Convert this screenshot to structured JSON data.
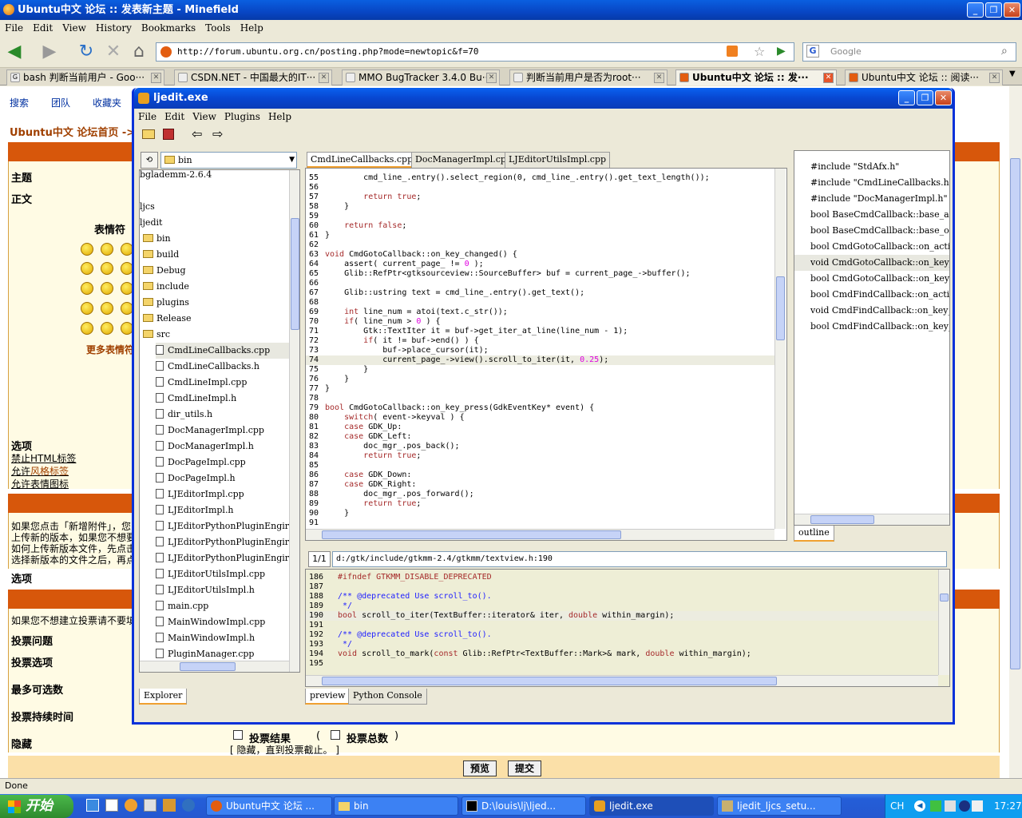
{
  "firefox": {
    "title": "Ubuntu中文 论坛 :: 发表新主题 - Minefield",
    "menu": [
      "File",
      "Edit",
      "View",
      "History",
      "Bookmarks",
      "Tools",
      "Help"
    ],
    "url": "http://forum.ubuntu.org.cn/posting.php?mode=newtopic&f=70",
    "search_placeholder": "Google",
    "tabs": [
      {
        "label": "bash 判断当前用户 - Goo···"
      },
      {
        "label": "CSDN.NET - 中国最大的IT···"
      },
      {
        "label": "MMO BugTracker 3.4.0 Bu···"
      },
      {
        "label": "判断当前用户是否为root···"
      },
      {
        "label": "Ubuntu中文 论坛 :: 发···"
      },
      {
        "label": "Ubuntu中文 论坛 :: 阅读···"
      }
    ],
    "status": "Done"
  },
  "forum": {
    "toplinks": [
      "搜索",
      "团队",
      "收藏夹"
    ],
    "breadcrumb": "Ubuntu中文 论坛首页 ->",
    "subject_label": "主题",
    "body_label": "正文",
    "smilies_label": "表情符",
    "more_smilies": "更多表情符",
    "options_label": "选项",
    "opt_html": "禁止HTML标签",
    "opt_bbcode_prefix": "允许",
    "opt_bbcode_link": "风格标签",
    "opt_smilies": "允许表情图标",
    "attach_lines": [
      "如果您点击「新增附件」，您",
      "上传新的版本，如果您不想要",
      "如何上传新版本文件，先点击",
      "选择新版本的文件之后，再点"
    ],
    "options_label2": "选项",
    "poll_note": "如果您不想建立投票请不要填",
    "poll_question": "投票问题",
    "poll_option": "投票选项",
    "poll_max": "最多可选数",
    "poll_length": "投票持续时间",
    "hide": "隐藏",
    "poll_result": "投票结果",
    "poll_total": "投票总数",
    "hide_note": "[ 隐藏，直到投票截止。 ]",
    "preview_btn": "预览",
    "submit_btn": "提交"
  },
  "ljedit": {
    "title": "ljedit.exe",
    "menu": [
      "File",
      "Edit",
      "View",
      "Plugins",
      "Help"
    ],
    "explorer_path": "bin",
    "tree": [
      {
        "label": "bglademm-2.6.4",
        "type": "text",
        "indent": 0
      },
      {
        "label": "",
        "type": "text",
        "indent": 0
      },
      {
        "label": "ljcs",
        "type": "text",
        "indent": 0
      },
      {
        "label": "ljedit",
        "type": "text",
        "indent": 0
      },
      {
        "label": "bin",
        "type": "folder",
        "indent": 1
      },
      {
        "label": "build",
        "type": "folder",
        "indent": 1
      },
      {
        "label": "Debug",
        "type": "folder",
        "indent": 1
      },
      {
        "label": "include",
        "type": "folder",
        "indent": 1
      },
      {
        "label": "plugins",
        "type": "folder",
        "indent": 1
      },
      {
        "label": "Release",
        "type": "folder",
        "indent": 1
      },
      {
        "label": "src",
        "type": "folder",
        "indent": 1
      },
      {
        "label": "CmdLineCallbacks.cpp",
        "type": "file",
        "indent": 2
      },
      {
        "label": "CmdLineCallbacks.h",
        "type": "file",
        "indent": 2
      },
      {
        "label": "CmdLineImpl.cpp",
        "type": "file",
        "indent": 2
      },
      {
        "label": "CmdLineImpl.h",
        "type": "file",
        "indent": 2
      },
      {
        "label": "dir_utils.h",
        "type": "file",
        "indent": 2
      },
      {
        "label": "DocManagerImpl.cpp",
        "type": "file",
        "indent": 2
      },
      {
        "label": "DocManagerImpl.h",
        "type": "file",
        "indent": 2
      },
      {
        "label": "DocPageImpl.cpp",
        "type": "file",
        "indent": 2
      },
      {
        "label": "DocPageImpl.h",
        "type": "file",
        "indent": 2
      },
      {
        "label": "LJEditorImpl.cpp",
        "type": "file",
        "indent": 2
      },
      {
        "label": "LJEditorImpl.h",
        "type": "file",
        "indent": 2
      },
      {
        "label": "LJEditorPythonPluginEngir",
        "type": "file",
        "indent": 2
      },
      {
        "label": "LJEditorPythonPluginEngir",
        "type": "file",
        "indent": 2
      },
      {
        "label": "LJEditorPythonPluginEngir",
        "type": "file",
        "indent": 2
      },
      {
        "label": "LJEditorUtilsImpl.cpp",
        "type": "file",
        "indent": 2
      },
      {
        "label": "LJEditorUtilsImpl.h",
        "type": "file",
        "indent": 2
      },
      {
        "label": "main.cpp",
        "type": "file",
        "indent": 2
      },
      {
        "label": "MainWindowImpl.cpp",
        "type": "file",
        "indent": 2
      },
      {
        "label": "MainWindowImpl.h",
        "type": "file",
        "indent": 2
      },
      {
        "label": "PluginManager.cpp",
        "type": "file",
        "indent": 2
      },
      {
        "label": "PluginManager.h",
        "type": "file",
        "indent": 2
      }
    ],
    "editor_tabs": [
      "CmdLineCallbacks.cpp",
      "DocManagerImpl.cpp",
      "LJEditorUtilsImpl.cpp"
    ],
    "code_lines": [
      {
        "n": "55",
        "t": "        cmd_line_.entry().select_region(0, cmd_line_.entry().get_text_length());"
      },
      {
        "n": "56",
        "t": ""
      },
      {
        "n": "57",
        "t": "        return true;"
      },
      {
        "n": "58",
        "t": "    }"
      },
      {
        "n": "59",
        "t": ""
      },
      {
        "n": "60",
        "t": "    return false;"
      },
      {
        "n": "61",
        "t": "}"
      },
      {
        "n": "62",
        "t": ""
      },
      {
        "n": "63",
        "t": "void CmdGotoCallback::on_key_changed() {"
      },
      {
        "n": "64",
        "t": "    assert( current_page_ != 0 );"
      },
      {
        "n": "65",
        "t": "    Glib::RefPtr<gtksourceview::SourceBuffer> buf = current_page_->buffer();"
      },
      {
        "n": "66",
        "t": ""
      },
      {
        "n": "67",
        "t": "    Glib::ustring text = cmd_line_.entry().get_text();"
      },
      {
        "n": "68",
        "t": ""
      },
      {
        "n": "69",
        "t": "    int line_num = atoi(text.c_str());"
      },
      {
        "n": "70",
        "t": "    if( line_num > 0 ) {"
      },
      {
        "n": "71",
        "t": "        Gtk::TextIter it = buf->get_iter_at_line(line_num - 1);"
      },
      {
        "n": "72",
        "t": "        if( it != buf->end() ) {"
      },
      {
        "n": "73",
        "t": "            buf->place_cursor(it);"
      },
      {
        "n": "74",
        "t": "            current_page_->view().scroll_to_iter(it, 0.25);"
      },
      {
        "n": "75",
        "t": "        }"
      },
      {
        "n": "76",
        "t": "    }"
      },
      {
        "n": "77",
        "t": "}"
      },
      {
        "n": "78",
        "t": ""
      },
      {
        "n": "79",
        "t": "bool CmdGotoCallback::on_key_press(GdkEventKey* event) {"
      },
      {
        "n": "80",
        "t": "    switch( event->keyval ) {"
      },
      {
        "n": "81",
        "t": "    case GDK_Up:"
      },
      {
        "n": "82",
        "t": "    case GDK_Left:"
      },
      {
        "n": "83",
        "t": "        doc_mgr_.pos_back();"
      },
      {
        "n": "84",
        "t": "        return true;"
      },
      {
        "n": "85",
        "t": ""
      },
      {
        "n": "86",
        "t": "    case GDK_Down:"
      },
      {
        "n": "87",
        "t": "    case GDK_Right:"
      },
      {
        "n": "88",
        "t": "        doc_mgr_.pos_forward();"
      },
      {
        "n": "89",
        "t": "        return true;"
      },
      {
        "n": "90",
        "t": "    }"
      },
      {
        "n": "91",
        "t": ""
      }
    ],
    "outline": [
      "#include \"StdAfx.h\"",
      "#include \"CmdLineCallbacks.h\"",
      "#include \"DocManagerImpl.h\"",
      "bool BaseCmdCallback::base_act",
      "bool BaseCmdCallback::base_on_",
      "bool CmdGotoCallback::on_activ",
      "void CmdGotoCallback::on_key_c",
      "bool CmdGotoCallback::on_key_p",
      "bool CmdFindCallback::on_activ",
      "void CmdFindCallback::on_key_c",
      "bool CmdFindCallback::on_key_p"
    ],
    "outline_tab": "outline",
    "preview_count": "1/1",
    "preview_path": "d:/gtk/include/gtkmm-2.4/gtkmm/textview.h:190",
    "preview_lines": [
      {
        "n": "186",
        "t": "#ifndef GTKMM_DISABLE_DEPRECATED"
      },
      {
        "n": "187",
        "t": ""
      },
      {
        "n": "188",
        "t": "/** @deprecated Use scroll_to()."
      },
      {
        "n": "189",
        "t": " */"
      },
      {
        "n": "190",
        "t": "bool scroll_to_iter(TextBuffer::iterator& iter, double within_margin);"
      },
      {
        "n": "191",
        "t": ""
      },
      {
        "n": "192",
        "t": "/** @deprecated Use scroll_to()."
      },
      {
        "n": "193",
        "t": " */"
      },
      {
        "n": "194",
        "t": "void scroll_to_mark(const Glib::RefPtr<TextBuffer::Mark>& mark, double within_margin);"
      },
      {
        "n": "195",
        "t": ""
      }
    ],
    "bottom_tabs": [
      "preview",
      "Python Console"
    ],
    "explorer_tab": "Explorer"
  },
  "taskbar": {
    "start": "开始",
    "items": [
      "Ubuntu中文 论坛 ...",
      "bin",
      "D:\\louis\\lj\\ljed...",
      "ljedit.exe",
      "ljedit_ljcs_setu..."
    ],
    "lang": "CH",
    "clock": "17:27"
  },
  "colors": {
    "xp_blue": "#0846c4",
    "forum_orange": "#d7570b",
    "code_keyword": "#a52a2a",
    "code_number": "#e000e0",
    "code_comment": "#2020ff"
  }
}
